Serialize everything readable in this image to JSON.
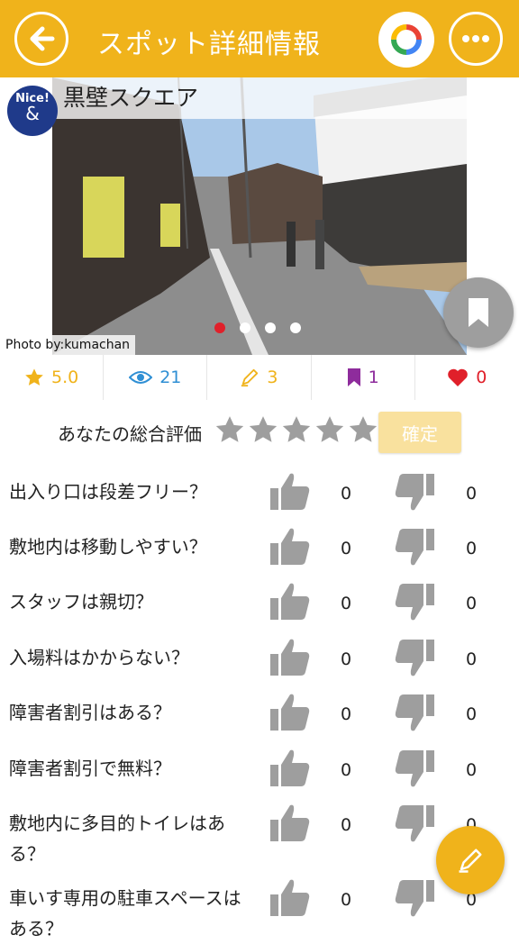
{
  "header": {
    "title": "スポット詳細情報"
  },
  "spot": {
    "name": "黒壁スクエア",
    "badge_line1": "Nice!",
    "badge_line2": "&",
    "photo_credit": "Photo by:kumachan"
  },
  "carousel": {
    "page_count": 4,
    "active_index": 0
  },
  "stats": [
    {
      "icon": "star-icon",
      "value": "5.0",
      "color": "#f0b31b"
    },
    {
      "icon": "eye-icon",
      "value": "21",
      "color": "#2f8fd4"
    },
    {
      "icon": "pencil-icon",
      "value": "3",
      "color": "#f0b31b"
    },
    {
      "icon": "bookmark-icon",
      "value": "1",
      "color": "#8e2c9c"
    },
    {
      "icon": "heart-icon",
      "value": "0",
      "color": "#e0202a"
    }
  ],
  "rating": {
    "label": "あなたの総合評価",
    "star_count": 5,
    "confirm_label": "確定"
  },
  "questions": [
    {
      "text": "出入り口は段差フリー？",
      "up": "0",
      "down": "0"
    },
    {
      "text": "敷地内は移動しやすい？",
      "up": "0",
      "down": "0"
    },
    {
      "text": "スタッフは親切？",
      "up": "0",
      "down": "0"
    },
    {
      "text": "入場料はかからない？",
      "up": "0",
      "down": "0"
    },
    {
      "text": "障害者割引はある？",
      "up": "0",
      "down": "0"
    },
    {
      "text": "障害者割引で無料？",
      "up": "0",
      "down": "0"
    },
    {
      "text": "敷地内に多目的トイレはある？",
      "up": "0",
      "down": "0"
    },
    {
      "text": "車いす専用の駐車スペースはある？",
      "up": "0",
      "down": "0"
    }
  ],
  "colors": {
    "accent": "#f0b31b",
    "thumb": "#9e9e9e"
  }
}
